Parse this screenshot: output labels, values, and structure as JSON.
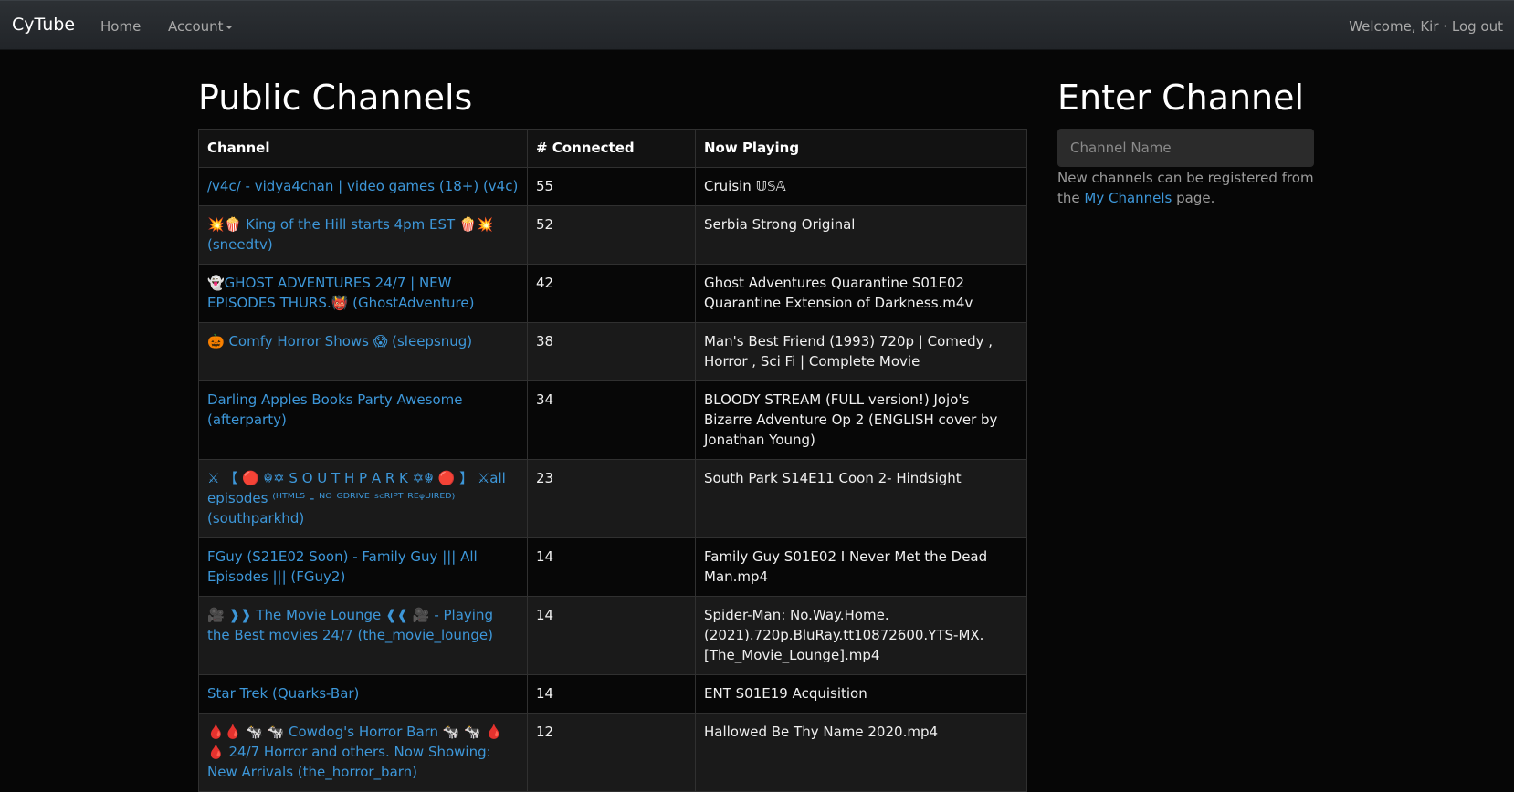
{
  "navbar": {
    "brand": "CyTube",
    "home": "Home",
    "account": "Account",
    "welcome": "Welcome, Kir",
    "separator": "·",
    "logout": "Log out"
  },
  "main": {
    "title": "Public Channels",
    "columns": [
      "Channel",
      "# Connected",
      "Now Playing"
    ],
    "rows": [
      {
        "channel": "/v4c/ - vidya4chan | video games (18+) (v4c)",
        "connected": "55",
        "now_playing": "Cruisin 𝕌𝕊𝔸"
      },
      {
        "channel": "💥🍿 King of the Hill starts 4pm EST 🍿💥 (sneedtv)",
        "connected": "52",
        "now_playing": "Serbia Strong Original"
      },
      {
        "channel": "👻GHOST ADVENTURES 24/7 | NEW EPISODES THURS.👹 (GhostAdventure)",
        "connected": "42",
        "now_playing": "Ghost Adventures Quarantine S01E02 Quarantine Extension of Darkness.m4v"
      },
      {
        "channel": "🎃 Comfy Horror Shows 😱 (sleepsnug)",
        "connected": "38",
        "now_playing": "Man's Best Friend (1993) 720p | Comedy , Horror , Sci Fi | Complete Movie"
      },
      {
        "channel": "Darling Apples Books Party Awesome (afterparty)",
        "connected": "34",
        "now_playing": "BLOODY STREAM (FULL version!) Jojo's Bizarre Adventure Op 2 (ENGLISH cover by Jonathan Young)"
      },
      {
        "channel": "⚔ 【 🔴 ☬✡ S O U T H P A R K ✡☬ 🔴 】 ⚔all episodes ⁽ᴴᵀᴹᴸ⁵ - ᴺᴼ ᴳᴰᴿᴵⱽᴱ ˢᶜᴿᴵᴾᵀ ᴿᴱᵠᵁᴵᴿᴱᴰ⁾ (southparkhd)",
        "connected": "23",
        "now_playing": "South Park S14E11 Coon 2- Hindsight"
      },
      {
        "channel": "FGuy (S21E02 Soon) - Family Guy ||| All Episodes ||| (FGuy2)",
        "connected": "14",
        "now_playing": "Family Guy S01E02 I Never Met the Dead Man.mp4"
      },
      {
        "channel": "🎥 ❱❱ The Movie Lounge ❰❰ 🎥 - Playing the Best movies 24/7 (the_movie_lounge)",
        "connected": "14",
        "now_playing": "Spider-Man: No.Way.Home.(2021).720p.BluRay.tt10872600.YTS-MX.[The_Movie_Lounge].mp4"
      },
      {
        "channel": "Star Trek (Quarks-Bar)",
        "connected": "14",
        "now_playing": "ENT S01E19 Acquisition"
      },
      {
        "channel": "🩸🩸 🐄 🐄 Cowdog's Horror Barn 🐄 🐄 🩸🩸 24/7 Horror and others. Now Showing: New Arrivals (the_horror_barn)",
        "connected": "12",
        "now_playing": "Hallowed Be Thy Name 2020.mp4"
      }
    ]
  },
  "sidebar": {
    "title": "Enter Channel",
    "input_placeholder": "Channel Name",
    "help_prefix": "New channels can be registered from the ",
    "help_link": "My Channels",
    "help_suffix": " page."
  },
  "colors": {
    "link": "#3d97d9",
    "background": "#060606",
    "navbar": "#272b30"
  }
}
